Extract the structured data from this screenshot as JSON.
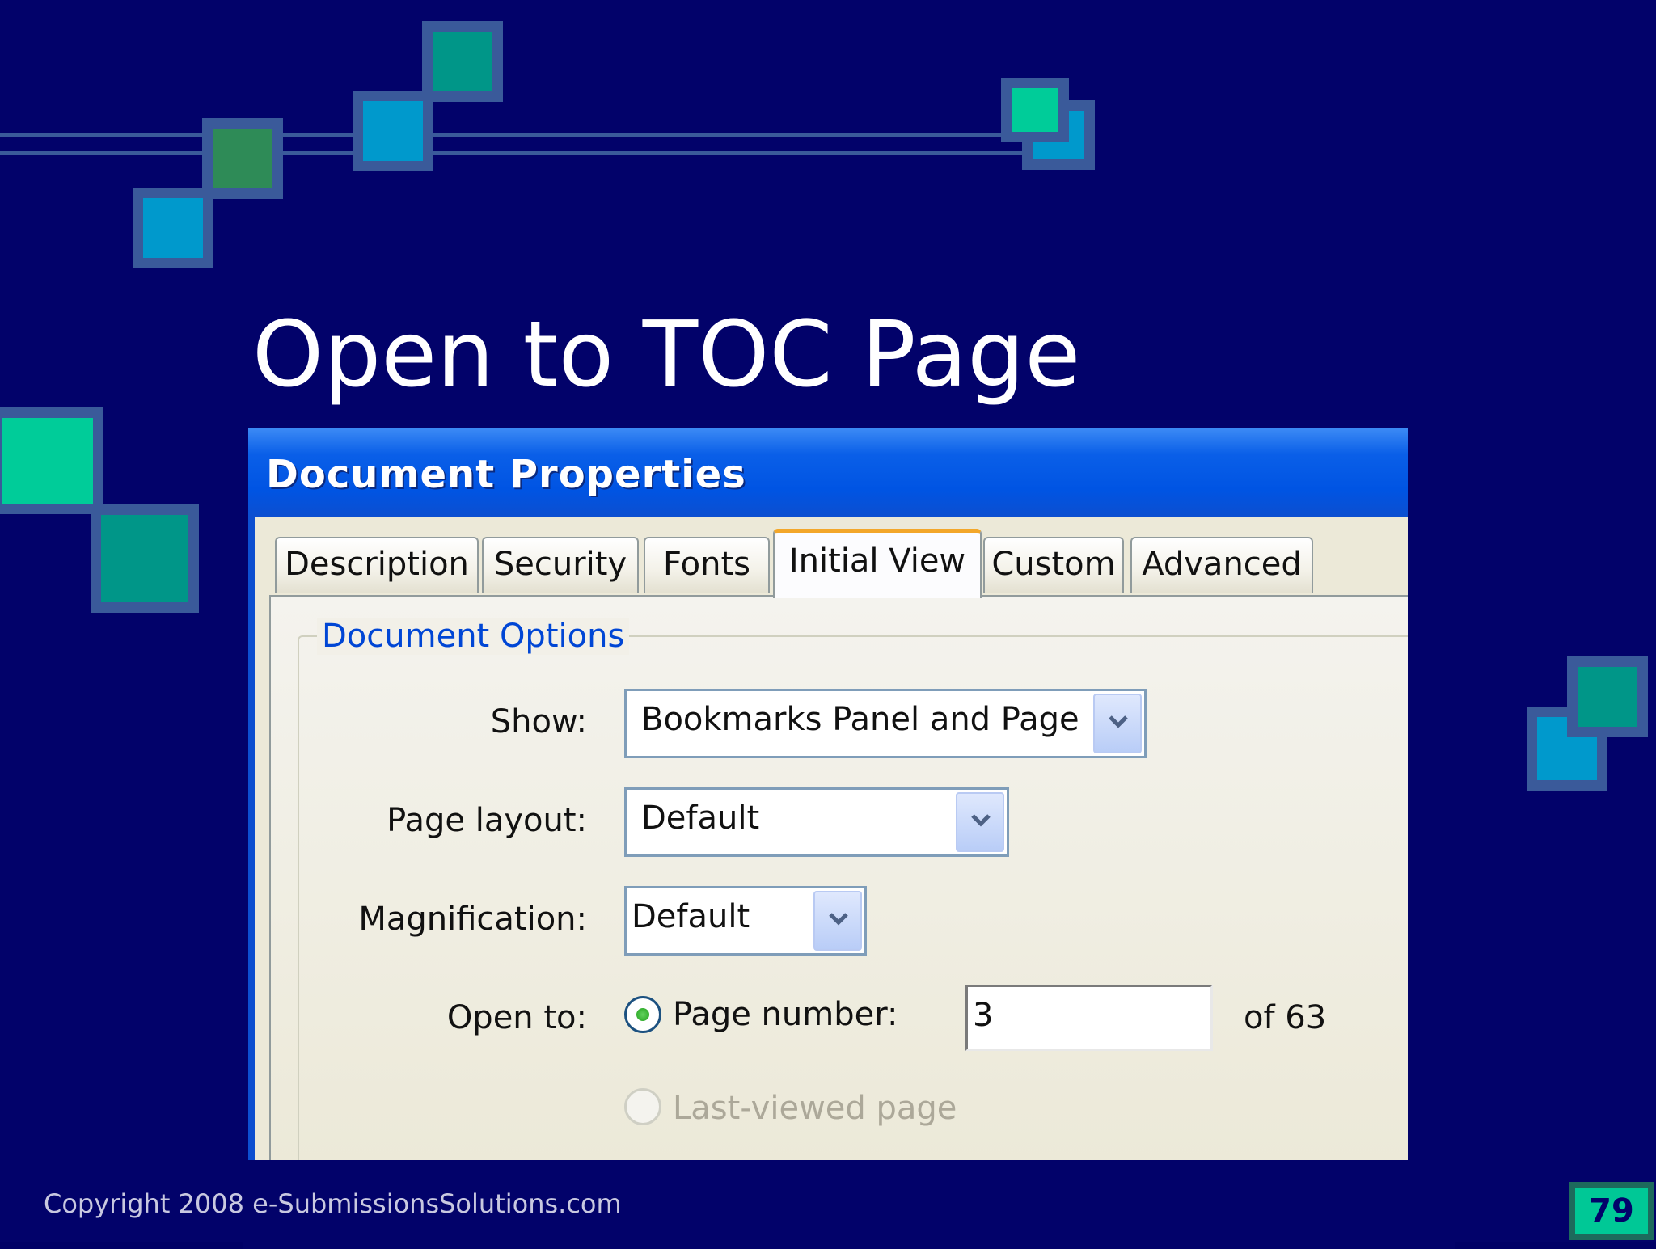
{
  "slide": {
    "title": "Open to TOC Page",
    "copyright": "Copyright 2008 e-SubmissionsSolutions.com",
    "slide_number": "79"
  },
  "colors": {
    "background": "#02026a",
    "square_teal": "#009688",
    "square_blue": "#0099cc",
    "square_green": "#2e8b57",
    "square_mint": "#00cc99",
    "square_border": "#3a5a9a",
    "titlebar_blue": "#0054e3",
    "dialog_bg": "#ece9d8",
    "active_tab_accent": "#f3a72a",
    "group_label": "#0046d5"
  },
  "dialog": {
    "title": "Document Properties",
    "tabs": [
      {
        "label": "Description",
        "active": false
      },
      {
        "label": "Security",
        "active": false
      },
      {
        "label": "Fonts",
        "active": false
      },
      {
        "label": "Initial View",
        "active": true
      },
      {
        "label": "Custom",
        "active": false
      },
      {
        "label": "Advanced",
        "active": false
      }
    ],
    "group_label": "Document Options",
    "show_label": "Show:",
    "show_value": "Bookmarks Panel and Page",
    "page_layout_label": "Page layout:",
    "page_layout_value": "Default",
    "magnification_label": "Magnification:",
    "magnification_value": "Default",
    "open_to_label": "Open to:",
    "page_number_label": "Page number:",
    "page_number_value": "3",
    "page_total": "of 63",
    "last_viewed_label": "Last-viewed page",
    "dropdown_icon": "chevron-down-icon"
  }
}
